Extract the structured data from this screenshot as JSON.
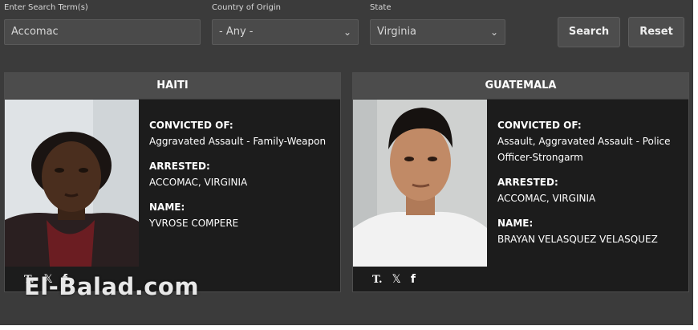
{
  "search": {
    "term_label": "Enter Search Term(s)",
    "term_value": "Accomac",
    "country_label": "Country of Origin",
    "country_value": "- Any -",
    "state_label": "State",
    "state_value": "Virginia",
    "search_button": "Search",
    "reset_button": "Reset"
  },
  "cards": [
    {
      "country": "HAITI",
      "convicted_label": "CONVICTED OF:",
      "convicted_value": "Aggravated Assault - Family-Weapon",
      "arrested_label": "ARRESTED:",
      "arrested_value": "ACCOMAC, VIRGINIA",
      "name_label": "NAME:",
      "name_value": "YVROSE COMPERE"
    },
    {
      "country": "GUATEMALA",
      "convicted_label": "CONVICTED OF:",
      "convicted_value": "Assault, Aggravated Assault - Police Officer-Strongarm",
      "arrested_label": "ARRESTED:",
      "arrested_value": "ACCOMAC, VIRGINIA",
      "name_label": "NAME:",
      "name_value": "BRAYAN VELASQUEZ VELASQUEZ"
    }
  ],
  "share_icons": [
    "t-logo-icon",
    "x-logo-icon",
    "facebook-icon"
  ],
  "watermark": "El-Balad.com"
}
